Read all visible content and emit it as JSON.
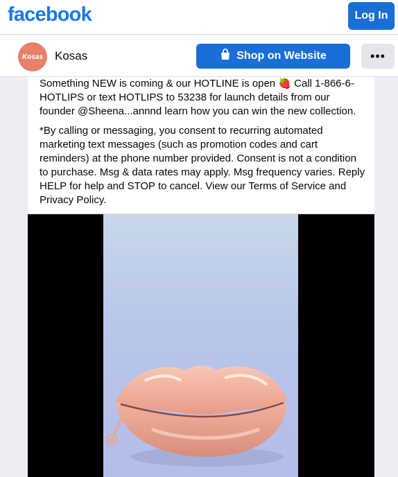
{
  "header": {
    "logo_text": "facebook",
    "login_label": "Log In",
    "brand_color": "#1877f2"
  },
  "page": {
    "name": "Kosas",
    "avatar_text": "Kosas",
    "shop_label": "Shop on Website",
    "shop_icon": "shopping-bag-icon",
    "more_icon": "more-options-icon",
    "more_glyph": "•••"
  },
  "post": {
    "paragraphs": [
      "Something NEW is coming & our HOTLINE is open 🍓 Call 1-866-6-HOTLIPS or text HOTLIPS to 53238 for launch details from our founder @Sheena...annnd learn how you can win the new collection.",
      "*By calling or messaging, you consent to recurring automated marketing text messages (such as promotion codes and cart reminders) at the phone number provided. Consent is not a condition to purchase. Msg & data rates may apply. Msg frequency varies. Reply HELP for help and STOP to cancel. View our Terms of Service and Privacy Policy."
    ]
  },
  "media": {
    "subject": "lips-phone-image"
  }
}
